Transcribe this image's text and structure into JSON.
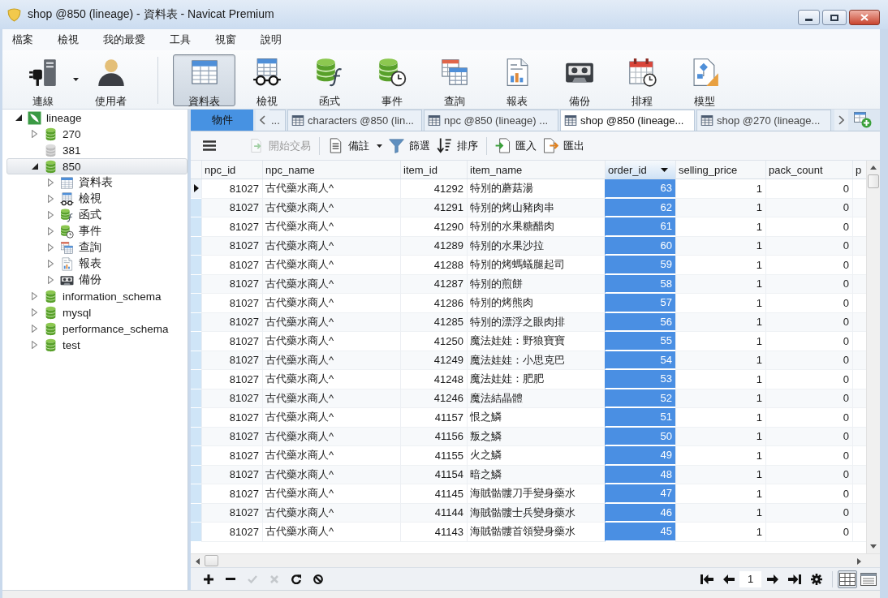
{
  "window": {
    "title": "shop @850 (lineage) - 資料表 - Navicat Premium"
  },
  "menu": [
    "檔案",
    "檢視",
    "我的最愛",
    "工具",
    "視窗",
    "說明"
  ],
  "toolbar": [
    {
      "label": "連線",
      "kind": "connection",
      "selected": false,
      "dropdown": true,
      "separated": false
    },
    {
      "label": "使用者",
      "kind": "user",
      "selected": false,
      "dropdown": false,
      "separated": false
    },
    {
      "label": "資料表",
      "kind": "tables",
      "selected": true,
      "dropdown": false,
      "separated": true
    },
    {
      "label": "檢視",
      "kind": "views",
      "selected": false,
      "dropdown": false,
      "separated": false
    },
    {
      "label": "函式",
      "kind": "functions",
      "selected": false,
      "dropdown": false,
      "separated": false
    },
    {
      "label": "事件",
      "kind": "events",
      "selected": false,
      "dropdown": false,
      "separated": false
    },
    {
      "label": "查詢",
      "kind": "queries",
      "selected": false,
      "dropdown": false,
      "separated": false
    },
    {
      "label": "報表",
      "kind": "reports",
      "selected": false,
      "dropdown": false,
      "separated": false
    },
    {
      "label": "備份",
      "kind": "backups",
      "selected": false,
      "dropdown": false,
      "separated": false
    },
    {
      "label": "排程",
      "kind": "schedule",
      "selected": false,
      "dropdown": false,
      "separated": false
    },
    {
      "label": "模型",
      "kind": "model",
      "selected": false,
      "dropdown": false,
      "separated": false
    }
  ],
  "sidebar": {
    "tree": [
      {
        "label": "lineage",
        "kind": "connection",
        "expanded": true,
        "selected": false,
        "children": [
          {
            "label": "270",
            "kind": "database",
            "open": true,
            "expanded": false,
            "selected": false
          },
          {
            "label": "381",
            "kind": "database",
            "open": false,
            "selected": false
          },
          {
            "label": "850",
            "kind": "database",
            "open": true,
            "expanded": true,
            "selected": true,
            "children": [
              {
                "label": "資料表",
                "kind": "tables",
                "expanded": false,
                "selected": false
              },
              {
                "label": "檢視",
                "kind": "views",
                "expanded": false,
                "selected": false
              },
              {
                "label": "函式",
                "kind": "functions",
                "expanded": false,
                "selected": false
              },
              {
                "label": "事件",
                "kind": "events",
                "expanded": false,
                "selected": false
              },
              {
                "label": "查詢",
                "kind": "queries",
                "expanded": false,
                "selected": false
              },
              {
                "label": "報表",
                "kind": "reports",
                "expanded": false,
                "selected": false
              },
              {
                "label": "備份",
                "kind": "backups",
                "expanded": false,
                "selected": false
              }
            ]
          },
          {
            "label": "information_schema",
            "kind": "database",
            "open": true,
            "expanded": false,
            "selected": false
          },
          {
            "label": "mysql",
            "kind": "database",
            "open": true,
            "expanded": false,
            "selected": false
          },
          {
            "label": "performance_schema",
            "kind": "database",
            "open": true,
            "expanded": false,
            "selected": false
          },
          {
            "label": "test",
            "kind": "database",
            "open": true,
            "expanded": false,
            "selected": false
          }
        ]
      }
    ]
  },
  "object_tab": {
    "label": "物件"
  },
  "tabs": [
    {
      "label": "...",
      "kind": "clipped",
      "selected": false
    },
    {
      "label": "characters @850 (lin...",
      "kind": "table",
      "selected": false
    },
    {
      "label": "npc @850 (lineage) ...",
      "kind": "table",
      "selected": false
    },
    {
      "label": "shop @850 (lineage...",
      "kind": "table",
      "selected": true
    },
    {
      "label": "shop @270 (lineage...",
      "kind": "table",
      "selected": false
    }
  ],
  "object_toolbar": [
    {
      "label": "開始交易",
      "kind": "transaction",
      "disabled": true,
      "dropdown": false,
      "separated": false
    },
    {
      "label": "備註",
      "kind": "memo",
      "disabled": false,
      "dropdown": true,
      "separated": true
    },
    {
      "label": "篩選",
      "kind": "filter",
      "disabled": false,
      "dropdown": false,
      "separated": false
    },
    {
      "label": "排序",
      "kind": "sort",
      "disabled": false,
      "dropdown": false,
      "separated": false
    },
    {
      "label": "匯入",
      "kind": "import",
      "disabled": false,
      "dropdown": false,
      "separated": true
    },
    {
      "label": "匯出",
      "kind": "export",
      "disabled": false,
      "dropdown": false,
      "separated": false
    }
  ],
  "grid": {
    "columns": [
      {
        "label": "npc_id",
        "kind": "number",
        "selected": false
      },
      {
        "label": "npc_name",
        "kind": "text",
        "selected": false
      },
      {
        "label": "item_id",
        "kind": "number",
        "selected": false
      },
      {
        "label": "item_name",
        "kind": "text",
        "selected": false
      },
      {
        "label": "order_id",
        "kind": "number",
        "selected": true
      },
      {
        "label": "selling_price",
        "kind": "number",
        "selected": false
      },
      {
        "label": "pack_count",
        "kind": "number",
        "selected": false
      },
      {
        "label": "p",
        "kind": "text",
        "selected": false
      }
    ],
    "rows": [
      {
        "current": true,
        "cells": [
          "81027",
          "古代藥水商人^",
          "41292",
          "特別的蘑菇湯",
          "63",
          "1",
          "0"
        ]
      },
      {
        "current": false,
        "cells": [
          "81027",
          "古代藥水商人^",
          "41291",
          "特別的烤山豬肉串",
          "62",
          "1",
          "0"
        ]
      },
      {
        "current": false,
        "cells": [
          "81027",
          "古代藥水商人^",
          "41290",
          "特別的水果糖醋肉",
          "61",
          "1",
          "0"
        ]
      },
      {
        "current": false,
        "cells": [
          "81027",
          "古代藥水商人^",
          "41289",
          "特別的水果沙拉",
          "60",
          "1",
          "0"
        ]
      },
      {
        "current": false,
        "cells": [
          "81027",
          "古代藥水商人^",
          "41288",
          "特別的烤螞蟻腿起司",
          "59",
          "1",
          "0"
        ]
      },
      {
        "current": false,
        "cells": [
          "81027",
          "古代藥水商人^",
          "41287",
          "特別的煎餅",
          "58",
          "1",
          "0"
        ]
      },
      {
        "current": false,
        "cells": [
          "81027",
          "古代藥水商人^",
          "41286",
          "特別的烤熊肉",
          "57",
          "1",
          "0"
        ]
      },
      {
        "current": false,
        "cells": [
          "81027",
          "古代藥水商人^",
          "41285",
          "特別的漂浮之眼肉排",
          "56",
          "1",
          "0"
        ]
      },
      {
        "current": false,
        "cells": [
          "81027",
          "古代藥水商人^",
          "41250",
          "魔法娃娃：野狼寶寶",
          "55",
          "1",
          "0"
        ]
      },
      {
        "current": false,
        "cells": [
          "81027",
          "古代藥水商人^",
          "41249",
          "魔法娃娃：小思克巴",
          "54",
          "1",
          "0"
        ]
      },
      {
        "current": false,
        "cells": [
          "81027",
          "古代藥水商人^",
          "41248",
          "魔法娃娃：肥肥",
          "53",
          "1",
          "0"
        ]
      },
      {
        "current": false,
        "cells": [
          "81027",
          "古代藥水商人^",
          "41246",
          "魔法結晶體",
          "52",
          "1",
          "0"
        ]
      },
      {
        "current": false,
        "cells": [
          "81027",
          "古代藥水商人^",
          "41157",
          "恨之鱗",
          "51",
          "1",
          "0"
        ]
      },
      {
        "current": false,
        "cells": [
          "81027",
          "古代藥水商人^",
          "41156",
          "叛之鱗",
          "50",
          "1",
          "0"
        ]
      },
      {
        "current": false,
        "cells": [
          "81027",
          "古代藥水商人^",
          "41155",
          "火之鱗",
          "49",
          "1",
          "0"
        ]
      },
      {
        "current": false,
        "cells": [
          "81027",
          "古代藥水商人^",
          "41154",
          "暗之鱗",
          "48",
          "1",
          "0"
        ]
      },
      {
        "current": false,
        "cells": [
          "81027",
          "古代藥水商人^",
          "41145",
          "海賊骷髏刀手變身藥水",
          "47",
          "1",
          "0"
        ]
      },
      {
        "current": false,
        "cells": [
          "81027",
          "古代藥水商人^",
          "41144",
          "海賊骷髏士兵變身藥水",
          "46",
          "1",
          "0"
        ]
      },
      {
        "current": false,
        "cells": [
          "81027",
          "古代藥水商人^",
          "41143",
          "海賊骷髏首領變身藥水",
          "45",
          "1",
          "0"
        ]
      }
    ]
  },
  "record_actions": [
    {
      "kind": "add",
      "disabled": false
    },
    {
      "kind": "delete",
      "disabled": false
    },
    {
      "kind": "apply",
      "disabled": true
    },
    {
      "kind": "discard",
      "disabled": true
    },
    {
      "kind": "refresh",
      "disabled": false
    },
    {
      "kind": "stop",
      "disabled": false
    }
  ],
  "pager": {
    "page": "1"
  },
  "views": [
    {
      "kind": "grid",
      "selected": true
    },
    {
      "kind": "form",
      "selected": false
    }
  ]
}
